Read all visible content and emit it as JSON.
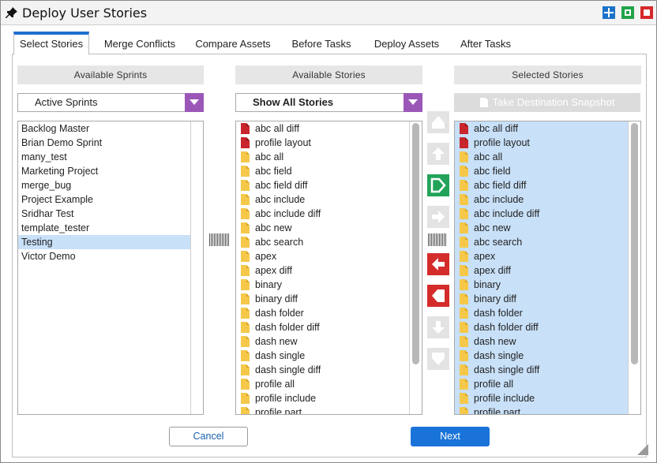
{
  "window": {
    "title": "Deploy User Stories"
  },
  "tabs": [
    {
      "label": "Select Stories",
      "active": true
    },
    {
      "label": "Merge Conflicts",
      "active": false
    },
    {
      "label": "Compare Assets",
      "active": false
    },
    {
      "label": "Before Tasks",
      "active": false
    },
    {
      "label": "Deploy Assets",
      "active": false
    },
    {
      "label": "After Tasks",
      "active": false
    }
  ],
  "sprints_panel": {
    "header": "Available Sprints",
    "filter_value": "Active Sprints",
    "items": [
      "Backlog Master",
      "Brian Demo Sprint",
      "many_test",
      "Marketing Project",
      "merge_bug",
      "Project Example",
      "Sridhar Test",
      "template_tester",
      "Testing",
      "Victor Demo"
    ],
    "selected": "Testing"
  },
  "stories_panel": {
    "header": "Available Stories",
    "filter_value": "Show All Stories",
    "items": [
      {
        "label": "abc all diff",
        "icon": "red-file-icon"
      },
      {
        "label": "profile layout",
        "icon": "red-file-icon"
      },
      {
        "label": "abc all",
        "icon": "yellow-file-icon"
      },
      {
        "label": "abc field",
        "icon": "yellow-file-icon"
      },
      {
        "label": "abc field diff",
        "icon": "yellow-file-icon"
      },
      {
        "label": "abc include",
        "icon": "yellow-file-icon"
      },
      {
        "label": "abc include diff",
        "icon": "yellow-file-icon"
      },
      {
        "label": "abc new",
        "icon": "yellow-file-icon"
      },
      {
        "label": "abc search",
        "icon": "yellow-file-icon"
      },
      {
        "label": "apex",
        "icon": "yellow-file-icon"
      },
      {
        "label": "apex diff",
        "icon": "yellow-file-icon"
      },
      {
        "label": "binary",
        "icon": "yellow-file-icon"
      },
      {
        "label": "binary diff",
        "icon": "yellow-file-icon"
      },
      {
        "label": "dash folder",
        "icon": "yellow-file-icon"
      },
      {
        "label": "dash folder diff",
        "icon": "yellow-file-icon"
      },
      {
        "label": "dash new",
        "icon": "yellow-file-icon"
      },
      {
        "label": "dash single",
        "icon": "yellow-file-icon"
      },
      {
        "label": "dash single diff",
        "icon": "yellow-file-icon"
      },
      {
        "label": "profile all",
        "icon": "yellow-file-icon"
      },
      {
        "label": "profile include",
        "icon": "yellow-file-icon"
      },
      {
        "label": "profile part",
        "icon": "yellow-file-icon"
      }
    ]
  },
  "selected_panel": {
    "header": "Selected Stories",
    "snapshot_button": "Take Destination Snapshot",
    "items": [
      {
        "label": "abc all diff",
        "icon": "red-file-icon"
      },
      {
        "label": "profile layout",
        "icon": "red-file-icon"
      },
      {
        "label": "abc all",
        "icon": "yellow-file-icon"
      },
      {
        "label": "abc field",
        "icon": "yellow-file-icon"
      },
      {
        "label": "abc field diff",
        "icon": "yellow-file-icon"
      },
      {
        "label": "abc include",
        "icon": "yellow-file-icon"
      },
      {
        "label": "abc include diff",
        "icon": "yellow-file-icon"
      },
      {
        "label": "abc new",
        "icon": "yellow-file-icon"
      },
      {
        "label": "abc search",
        "icon": "yellow-file-icon"
      },
      {
        "label": "apex",
        "icon": "yellow-file-icon"
      },
      {
        "label": "apex diff",
        "icon": "yellow-file-icon"
      },
      {
        "label": "binary",
        "icon": "yellow-file-icon"
      },
      {
        "label": "binary diff",
        "icon": "yellow-file-icon"
      },
      {
        "label": "dash folder",
        "icon": "yellow-file-icon"
      },
      {
        "label": "dash folder diff",
        "icon": "yellow-file-icon"
      },
      {
        "label": "dash new",
        "icon": "yellow-file-icon"
      },
      {
        "label": "dash single",
        "icon": "yellow-file-icon"
      },
      {
        "label": "dash single diff",
        "icon": "yellow-file-icon"
      },
      {
        "label": "profile all",
        "icon": "yellow-file-icon"
      },
      {
        "label": "profile include",
        "icon": "yellow-file-icon"
      },
      {
        "label": "profile part",
        "icon": "yellow-file-icon"
      }
    ]
  },
  "buttons": {
    "cancel": "Cancel",
    "next": "Next"
  },
  "colors": {
    "accent_blue": "#1a73d9",
    "dropdown_arrow": "#9b57b8",
    "add_green": "#23a35a",
    "remove_red": "#d42b2b",
    "selection_bg": "#c8e0f8"
  }
}
